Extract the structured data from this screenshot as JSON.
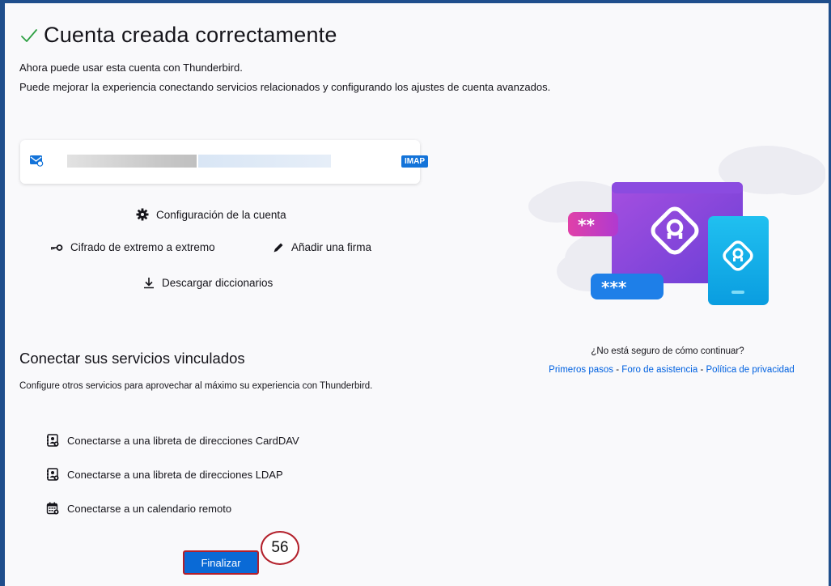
{
  "header": {
    "title": "Cuenta creada correctamente",
    "line1": "Ahora puede usar esta cuenta con Thunderbird.",
    "line2": "Puede mejorar la experiencia conectando servicios relacionados y configurando los ajustes de cuenta avanzados."
  },
  "account": {
    "protocol_badge": "IMAP"
  },
  "actions": {
    "config": "Configuración de la cuenta",
    "cifrado": "Cifrado de extremo a extremo",
    "firma": "Añadir una firma",
    "diccionarios": "Descargar diccionarios"
  },
  "services": {
    "title": "Conectar sus servicios vinculados",
    "description": "Configure otros servicios para aprovechar al máximo su experiencia con Thunderbird.",
    "items": [
      "Conectarse a una libreta de direcciones CardDAV",
      "Conectarse a una libreta de direcciones LDAP",
      "Conectarse a un calendario remoto"
    ]
  },
  "finish_label": "Finalizar",
  "step_number": "56",
  "help": {
    "question": "¿No está seguro de cómo continuar?",
    "link1": "Primeros pasos",
    "sep1": " - ",
    "link2": "Foro de asistencia",
    "sep2": " - ",
    "link3": "Política de privacidad"
  },
  "illustration": {
    "pill_pink": "**",
    "pill_blue": "***"
  },
  "colors": {
    "accent": "#0a6ad6",
    "check": "#2ea043",
    "badge": "#1373d9",
    "highlight": "#b3202b"
  }
}
